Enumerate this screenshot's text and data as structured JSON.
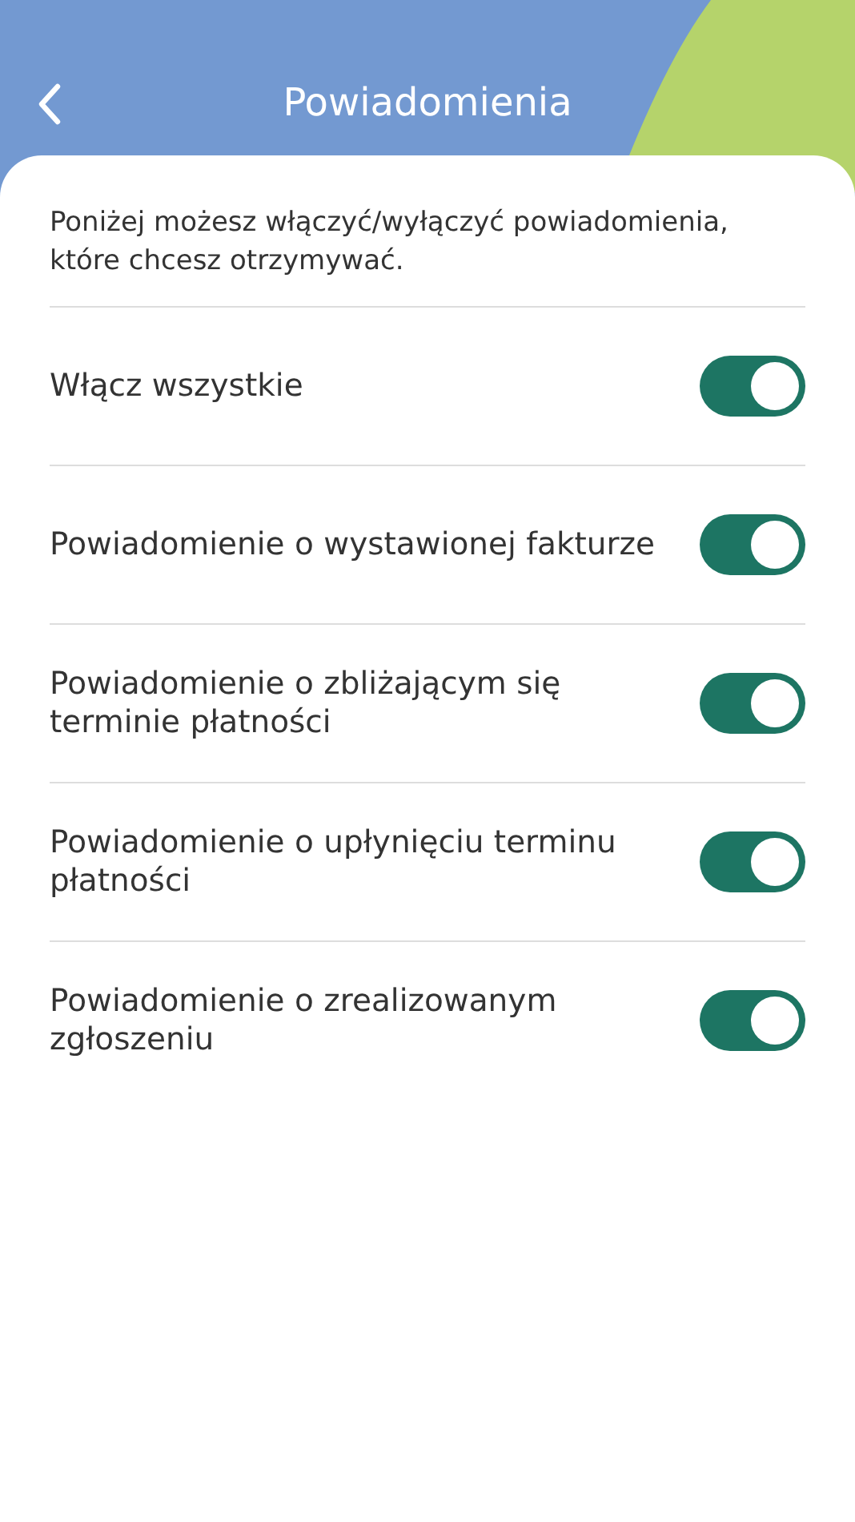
{
  "header": {
    "title": "Powiadomienia"
  },
  "intro": "Poniżej możesz włączyć/wyłączyć powiadomienia, które chcesz otrzymywać.",
  "settings": [
    {
      "label": "Włącz wszystkie",
      "on": true
    },
    {
      "label": "Powiadomienie o wystawionej fakturze",
      "on": true
    },
    {
      "label": "Powiadomienie o zbliżającym się terminie płatności",
      "on": true
    },
    {
      "label": "Powiadomienie o upłynięciu terminu płatności",
      "on": true
    },
    {
      "label": "Powiadomienie o zrealizowanym zgłoszeniu",
      "on": true
    }
  ]
}
